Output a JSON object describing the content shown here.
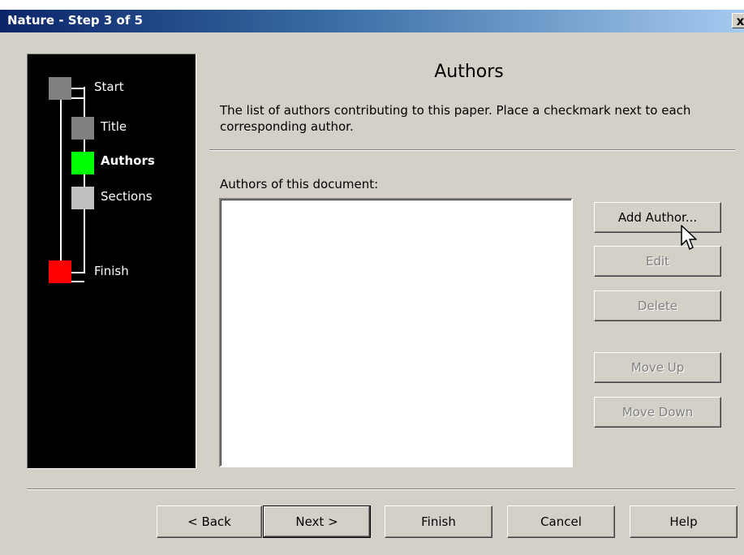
{
  "window": {
    "title": "Nature - Step 3 of 5",
    "close_label": "x"
  },
  "steps": [
    {
      "label": "Start",
      "color": "#808080",
      "state": "done"
    },
    {
      "label": "Title",
      "color": "#808080",
      "state": "done"
    },
    {
      "label": "Authors",
      "color": "#00ff00",
      "state": "current"
    },
    {
      "label": "Sections",
      "color": "#c0c0c0",
      "state": "pending"
    },
    {
      "label": "Finish",
      "color": "#ff0000",
      "state": "end"
    }
  ],
  "page": {
    "heading": "Authors",
    "description": "The list of authors contributing to this paper. Place a checkmark next to each corresponding author.",
    "list_label": "Authors of this document:",
    "authors": []
  },
  "side_buttons": {
    "add_author": "Add Author...",
    "edit": "Edit",
    "delete": "Delete",
    "move_up": "Move Up",
    "move_down": "Move Down"
  },
  "footer_buttons": {
    "back": "< Back",
    "next": "Next >",
    "finish": "Finish",
    "cancel": "Cancel",
    "help": "Help"
  },
  "icons": {
    "close": "close-icon",
    "cursor": "mouse-pointer-icon"
  }
}
